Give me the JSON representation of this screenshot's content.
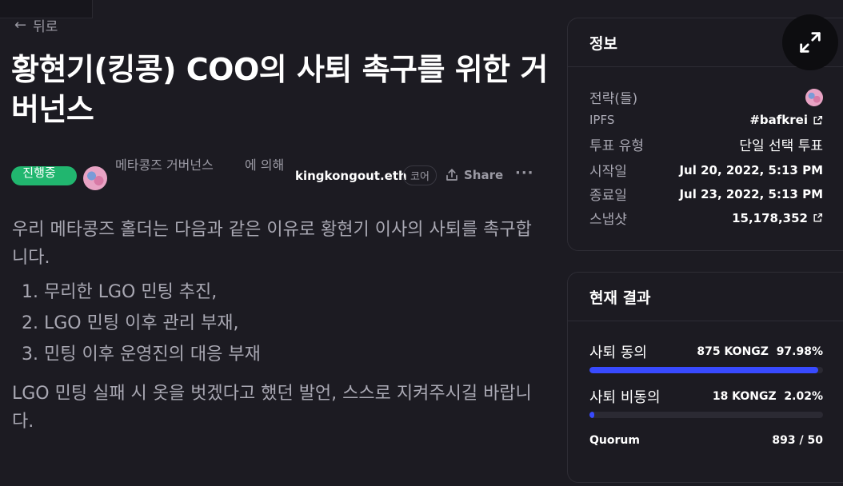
{
  "nav": {
    "back_label": "뒤로"
  },
  "proposal": {
    "title": "황현기(킹콩) COO의 사퇴 촉구를 위한 거버넌스",
    "status": "진행중",
    "space": "메타콩즈 거버넌스",
    "by_label": "에 의해",
    "author": "kingkongout.eth",
    "author_badge": "코어",
    "share_label": "Share",
    "more_label": "···",
    "body_intro": "우리 메타콩즈 홀더는 다음과 같은 이유로 황현기 이사의 사퇴를 촉구합니다.",
    "reasons": [
      "무리한 LGO 민팅 추진,",
      "LGO 민팅 이후 관리 부재,",
      "민팅 이후 운영진의 대응 부재"
    ],
    "body_outro": "LGO 민팅 실패 시 옷을 벗겠다고 했던 발언, 스스로 지켜주시길 바랍니다."
  },
  "info": {
    "title": "정보",
    "strategy_label": "전략(들)",
    "ipfs_label": "IPFS",
    "ipfs_value": "#bafkrei",
    "vote_type_label": "투표 유형",
    "vote_type_value": "단일 선택 투표",
    "start_label": "시작일",
    "start_value": "Jul 20, 2022, 5:13 PM",
    "end_label": "종료일",
    "end_value": "Jul 23, 2022, 5:13 PM",
    "snapshot_label": "스냅샷",
    "snapshot_value": "15,178,352"
  },
  "results": {
    "title": "현재 결과",
    "options": [
      {
        "label": "사퇴 동의",
        "amount": "875 KONGZ",
        "percent": "97.98%",
        "fraction": 0.9798
      },
      {
        "label": "사퇴 비동의",
        "amount": "18 KONGZ",
        "percent": "2.02%",
        "fraction": 0.0202
      }
    ],
    "quorum_label": "Quorum",
    "quorum_value": "893 / 50"
  },
  "colors": {
    "accent": "#384aff",
    "status_green": "#21b66f",
    "background": "#1c1b22"
  },
  "icons": {
    "back": "arrow-left-icon",
    "share": "share-icon",
    "external": "external-link-icon",
    "expand": "expand-icon"
  }
}
